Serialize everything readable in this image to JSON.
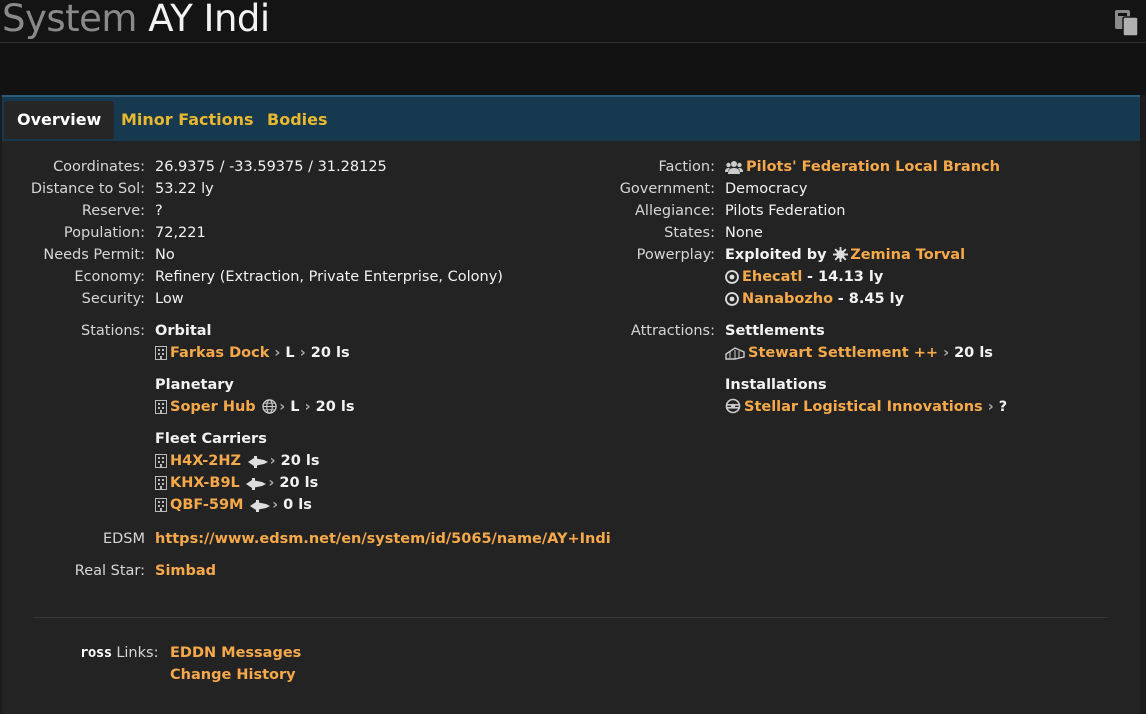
{
  "header": {
    "prefix": "System",
    "name": "AY Indi",
    "copy_icon": "clipboard-icon"
  },
  "tabs": [
    {
      "label": "Overview",
      "active": true
    },
    {
      "label": "Minor Factions",
      "active": false
    },
    {
      "label": "Bodies",
      "active": false
    }
  ],
  "left": {
    "coordinates": {
      "label": "Coordinates:",
      "value": "26.9375 / -33.59375 / 31.28125"
    },
    "distance": {
      "label": "Distance to Sol:",
      "value": "53.22 ly"
    },
    "reserve": {
      "label": "Reserve:",
      "value": "?"
    },
    "population": {
      "label": "Population:",
      "value": "72,221"
    },
    "permit": {
      "label": "Needs Permit:",
      "value": "No"
    },
    "economy": {
      "label": "Economy:",
      "value": "Refinery (Extraction, Private Enterprise, Colony)"
    },
    "security": {
      "label": "Security:",
      "value": "Low"
    }
  },
  "stations": {
    "label": "Stations:",
    "orbital": {
      "heading": "Orbital",
      "items": [
        {
          "name": "Farkas Dock",
          "size": "L",
          "distance": "20 ls"
        }
      ]
    },
    "planetary": {
      "heading": "Planetary",
      "items": [
        {
          "name": "Soper Hub",
          "size": "L",
          "distance": "20 ls"
        }
      ]
    },
    "carriers": {
      "heading": "Fleet Carriers",
      "items": [
        {
          "name": "H4X-2HZ",
          "distance": "20 ls"
        },
        {
          "name": "KHX-B9L",
          "distance": "20 ls"
        },
        {
          "name": "QBF-59M",
          "distance": "0 ls"
        }
      ]
    }
  },
  "edsm": {
    "label": "EDSM",
    "url": "https://www.edsm.net/en/system/id/5065/name/AY+Indi"
  },
  "real_star": {
    "label": "Real Star:",
    "value": "Simbad"
  },
  "right": {
    "faction": {
      "label": "Faction:",
      "value": "Pilots' Federation Local Branch"
    },
    "government": {
      "label": "Government:",
      "value": "Democracy"
    },
    "allegiance": {
      "label": "Allegiance:",
      "value": "Pilots Federation"
    },
    "states": {
      "label": "States:",
      "value": "None"
    },
    "powerplay": {
      "label": "Powerplay:",
      "status": "Exploited by",
      "power": "Zemina Torval",
      "sources": [
        {
          "name": "Ehecatl",
          "distance": "- 14.13 ly"
        },
        {
          "name": "Nanabozho",
          "distance": "- 8.45 ly"
        }
      ]
    },
    "attractions": {
      "label": "Attractions:",
      "settlements_heading": "Settlements",
      "settlement": {
        "name": "Stewart Settlement ++",
        "distance": "20 ls"
      },
      "installations_heading": "Installations",
      "installation": {
        "name": "Stellar Logistical Innovations",
        "distance": "?"
      }
    }
  },
  "footer": {
    "logo": "ross",
    "label": "Links:",
    "links": [
      "EDDN Messages",
      "Change History"
    ]
  },
  "colors": {
    "link": "#f6a94a",
    "tab_inactive": "#e8b830",
    "tab_bar": "#17394f",
    "panel": "#232323"
  }
}
